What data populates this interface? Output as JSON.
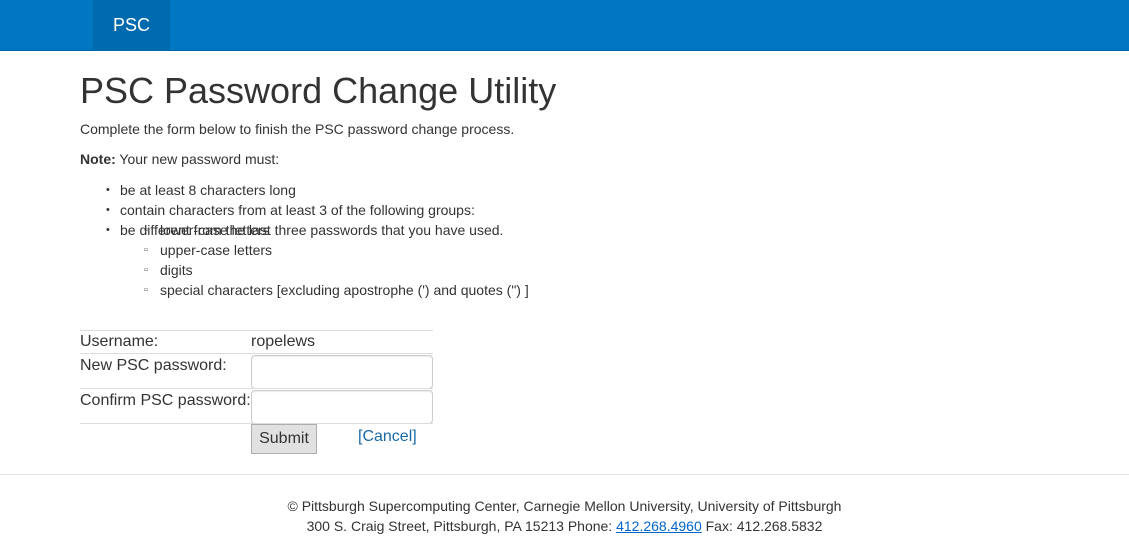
{
  "nav": {
    "brand": "PSC"
  },
  "page": {
    "title": "PSC Password Change Utility",
    "intro": "Complete the form below to finish the PSC password change process.",
    "note_label": "Note:",
    "note_text": " Your new password must:"
  },
  "requirements": {
    "length": "be at least 8 characters long",
    "groups": "contain characters from at least 3 of the following groups:",
    "group_items": [
      "lower-case letters",
      "upper-case letters",
      "digits",
      "special characters [excluding apostrophe (') and quotes (\") ]"
    ],
    "history": "be different from the last three passwords that you have used."
  },
  "form": {
    "username_label": "Username:",
    "username_value": "ropelews",
    "new_password_label": "New PSC password:",
    "new_password_value": "",
    "confirm_password_label": "Confirm PSC password:",
    "confirm_password_value": "",
    "submit_label": "Submit",
    "cancel_label": "[Cancel]"
  },
  "footer": {
    "line1": "© Pittsburgh Supercomputing Center, Carnegie Mellon University, University of Pittsburgh",
    "address": "300 S. Craig Street, Pittsburgh, PA 15213 Phone: ",
    "phone": "412.268.4960",
    "fax": " Fax: 412.268.5832"
  },
  "colors": {
    "navbar": "#0077c0",
    "brand_bg": "#006aae",
    "link": "#1a6aa8"
  }
}
